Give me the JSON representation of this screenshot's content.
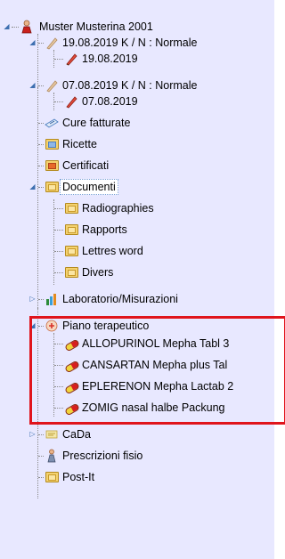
{
  "tree": {
    "patient": "Muster Musterina 2001",
    "items": [
      {
        "label": "19.08.2019 K / N : Normale",
        "icon": "pen-icon"
      },
      {
        "label": "19.08.2019",
        "icon": "pen-red-icon"
      },
      {
        "label": "07.08.2019 K / N : Normale",
        "icon": "pen-icon"
      },
      {
        "label": "07.08.2019",
        "icon": "pen-red-icon"
      },
      {
        "label": "Cure fatturate",
        "icon": "invoice-icon"
      },
      {
        "label": "Ricette",
        "icon": "folder-icon"
      },
      {
        "label": "Certificati",
        "icon": "folder-icon"
      },
      {
        "label": "Documenti",
        "icon": "folder-icon"
      },
      {
        "label": "Radiographies",
        "icon": "folder-icon"
      },
      {
        "label": "Rapports",
        "icon": "folder-icon"
      },
      {
        "label": "Lettres word",
        "icon": "folder-icon"
      },
      {
        "label": "Divers",
        "icon": "folder-icon"
      },
      {
        "label": "Laboratorio/Misurazioni",
        "icon": "lab-icon"
      },
      {
        "label": "Piano terapeutico",
        "icon": "therapy-icon"
      },
      {
        "label": "ALLOPURINOL Mepha Tabl 3",
        "icon": "pill-icon"
      },
      {
        "label": "CANSARTAN Mepha plus Tal",
        "icon": "pill-icon"
      },
      {
        "label": "EPLERENON Mepha Lactab 2",
        "icon": "pill-icon"
      },
      {
        "label": "ZOMIG nasal halbe Packung",
        "icon": "pill-icon"
      },
      {
        "label": "CaDa",
        "icon": "cada-icon"
      },
      {
        "label": "Prescrizioni fisio",
        "icon": "physio-icon"
      },
      {
        "label": "Post-It",
        "icon": "folder-icon"
      }
    ]
  },
  "highlight_color": "#e0141c"
}
